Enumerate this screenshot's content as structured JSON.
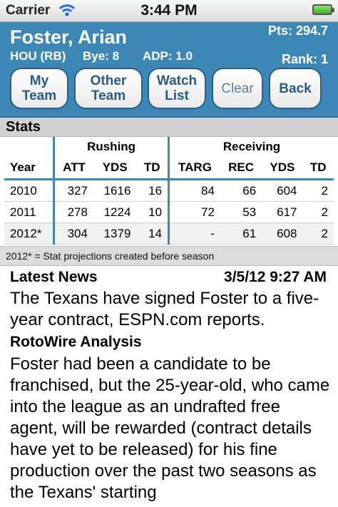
{
  "status_bar": {
    "carrier": "Carrier",
    "time": "3:44 PM",
    "wifi_icon": "wifi-icon",
    "battery_icon": "battery-icon"
  },
  "player": {
    "name": "Foster, Arian",
    "team_position": "HOU (RB)",
    "bye": "Bye: 8",
    "adp": "ADP: 1.0",
    "points": "Pts: 294.7",
    "rank": "Rank: 1"
  },
  "buttons": [
    {
      "line1": "My",
      "line2": "Team"
    },
    {
      "line1": "Other",
      "line2": "Team"
    },
    {
      "line1": "Watch",
      "line2": "List"
    },
    {
      "line1": "Clear",
      "line2": ""
    },
    {
      "line1": "Back",
      "line2": ""
    }
  ],
  "stats": {
    "title": "Stats",
    "groups": {
      "rushing": "Rushing",
      "receiving": "Receiving"
    },
    "columns": [
      "Year",
      "ATT",
      "YDS",
      "TD",
      "TARG",
      "REC",
      "YDS",
      "TD"
    ],
    "rows": [
      [
        "2010",
        "327",
        "1616",
        "16",
        "84",
        "66",
        "604",
        "2"
      ],
      [
        "2011",
        "278",
        "1224",
        "10",
        "72",
        "53",
        "617",
        "2"
      ],
      [
        "2012*",
        "304",
        "1379",
        "14",
        "-",
        "61",
        "608",
        "2"
      ]
    ],
    "footnote": "2012* = Stat projections created before season"
  },
  "news": {
    "label": "Latest News",
    "date": "3/5/12 9:27 AM",
    "body": "The Texans have signed Foster to a five-year contract,  ESPN.com reports."
  },
  "analysis": {
    "label": "RotoWire Analysis",
    "body": "Foster had been a candidate to be franchised, but the 25-year-old, who came into the league as an undrafted free agent, will be rewarded (contract details have yet to be released) for his fine production over the past two seasons as the Texans' starting"
  },
  "colors": {
    "header_bg": "#3d87b7",
    "button_text": "#2a5b84",
    "section_bg": "#d2d2d2"
  }
}
